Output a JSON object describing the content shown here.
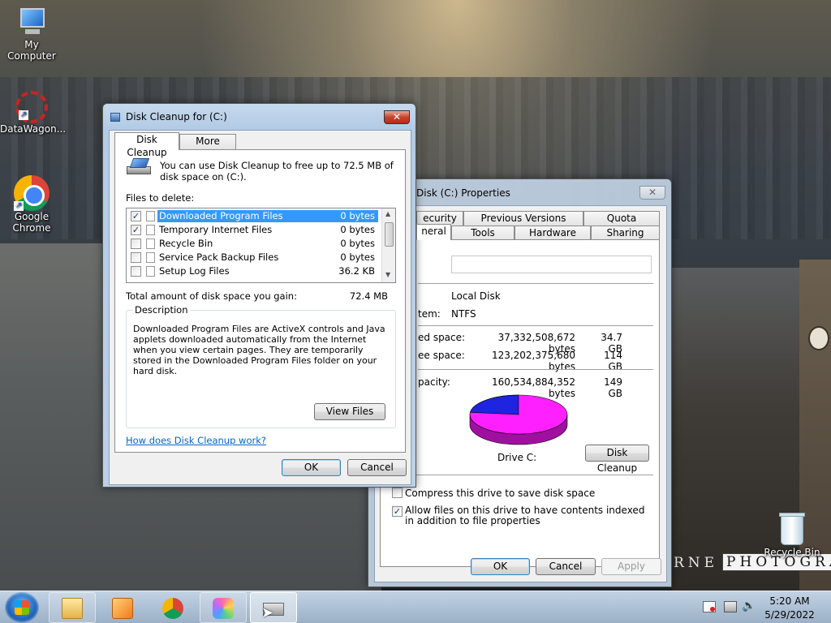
{
  "desktop": {
    "icons": [
      {
        "label": "My Computer"
      },
      {
        "label": "DataWagon..."
      },
      {
        "label": "Google Chrome"
      },
      {
        "label": "Recycle Bin"
      }
    ],
    "watermark": {
      "prefix": "RNE",
      "word": "PHOTOGRAPHY"
    }
  },
  "cleanup": {
    "title": "Disk Cleanup for  (C:)",
    "close": "✕",
    "tabs": [
      "Disk Cleanup",
      "More Options"
    ],
    "intro": "You can use Disk Cleanup to free up to 72.5 MB of disk space on  (C:).",
    "files_label": "Files to delete:",
    "files": [
      {
        "name": "Downloaded Program Files",
        "size": "0 bytes",
        "checked": true,
        "selected": true
      },
      {
        "name": "Temporary Internet Files",
        "size": "0 bytes",
        "checked": true,
        "selected": false
      },
      {
        "name": "Recycle Bin",
        "size": "0 bytes",
        "checked": false,
        "selected": false
      },
      {
        "name": "Service Pack Backup Files",
        "size": "0 bytes",
        "checked": false,
        "selected": false
      },
      {
        "name": "Setup Log Files",
        "size": "36.2 KB",
        "checked": false,
        "selected": false
      }
    ],
    "total_label": "Total amount of disk space you gain:",
    "total_value": "72.4 MB",
    "description_label": "Description",
    "description_text": "Downloaded Program Files are ActiveX controls and Java applets downloaded automatically from the Internet when you view certain pages. They are temporarily stored in the Downloaded Program Files folder on your hard disk.",
    "view_files": "View Files",
    "help_link": "How does Disk Cleanup work?",
    "ok": "OK",
    "cancel": "Cancel"
  },
  "properties": {
    "title": "Disk (C:) Properties",
    "close": "✕",
    "tabs_row1": [
      "ecurity",
      "Previous Versions",
      "Quota"
    ],
    "tabs_row2": [
      "neral",
      "Tools",
      "Hardware",
      "Sharing"
    ],
    "type_value": "Local Disk",
    "fs_label": "tem:",
    "fs_value": "NTFS",
    "used_label": "ed space:",
    "used_bytes": "37,332,508,672 bytes",
    "used_gb": "34.7 GB",
    "free_label": "ee space:",
    "free_bytes": "123,202,375,680 bytes",
    "free_gb": "114 GB",
    "cap_label": "pacity:",
    "cap_bytes": "160,534,884,352 bytes",
    "cap_gb": "149 GB",
    "drive_label": "Drive C:",
    "cleanup_button": "Disk Cleanup",
    "compress_label": "Compress this drive to save disk space",
    "compress_checked": false,
    "index_label": "Allow files on this drive to have contents indexed in addition to file properties",
    "index_checked": true,
    "ok": "OK",
    "cancel": "Cancel",
    "apply": "Apply",
    "pie": {
      "used_fraction": 0.232,
      "used_color": "#1f24e0",
      "free_color": "#ff20ff"
    }
  },
  "taskbar": {
    "buttons": [
      "explorer-icon",
      "media-player-icon",
      "chrome-icon",
      "paint-icon",
      "disk-cleanup-icon"
    ],
    "time": "5:20 AM",
    "date": "5/29/2022"
  }
}
